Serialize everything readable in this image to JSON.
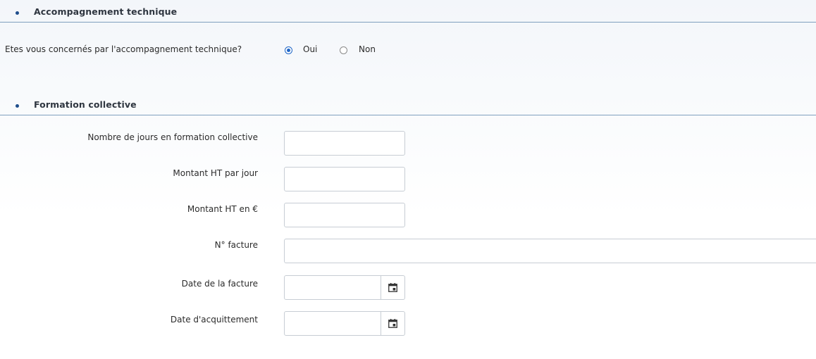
{
  "sections": {
    "technical": {
      "title": "Accompagnement technique"
    },
    "training": {
      "title": "Formation collective"
    }
  },
  "technical_support": {
    "question": "Etes vous concernés par l'accompagnement technique?",
    "options": [
      {
        "label": "Oui",
        "selected": true
      },
      {
        "label": "Non",
        "selected": false
      }
    ]
  },
  "training_fields": {
    "days": {
      "label": "Nombre de jours en formation collective",
      "value": ""
    },
    "amount_per_day": {
      "label": "Montant HT par jour",
      "value": ""
    },
    "amount_total": {
      "label": "Montant HT en €",
      "value": ""
    },
    "invoice_number": {
      "label": "N° facture",
      "value": ""
    },
    "invoice_date": {
      "label": "Date de la facture",
      "value": "",
      "icon": "calendar-icon"
    },
    "payment_date": {
      "label": "Date d'acquittement",
      "value": "",
      "icon": "calendar-icon"
    }
  },
  "colors": {
    "accent": "#1f66c7",
    "section_rule": "#7f9fbe",
    "bullet": "#1f4e8c"
  }
}
